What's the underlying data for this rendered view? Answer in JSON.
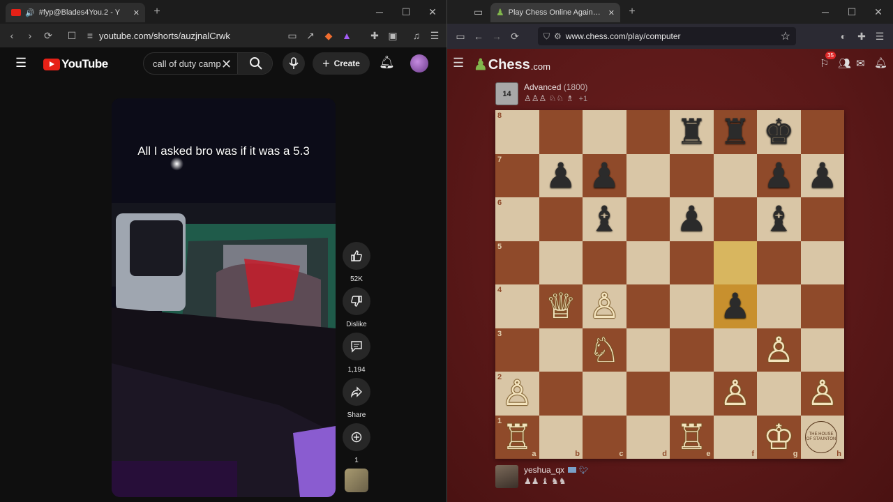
{
  "left_browser": {
    "tab_title": "#fyp@Blades4You.2 - Y",
    "url": "youtube.com/shorts/auzjnalCrwk",
    "window_controls": [
      "minimize",
      "maximize",
      "close"
    ]
  },
  "youtube": {
    "logo_text": "YouTube",
    "search_value": "call of duty camp",
    "create_label": "Create",
    "caption": "All I asked bro was if it was a 5.3",
    "actions": [
      {
        "icon": "thumbs-up-icon",
        "label": "52K"
      },
      {
        "icon": "thumbs-down-icon",
        "label": "Dislike"
      },
      {
        "icon": "comment-icon",
        "label": "1,194"
      },
      {
        "icon": "share-icon",
        "label": "Share"
      },
      {
        "icon": "remix-icon",
        "label": "1"
      }
    ]
  },
  "right_browser": {
    "tab_title": "Play Chess Online Against the C",
    "url": "www.chess.com/play/computer"
  },
  "chess": {
    "logo_text": "Chess",
    "logo_suffix": ".com",
    "notification_count": "35",
    "opponent": {
      "badge": "14",
      "name": "Advanced",
      "rating": "(1800)",
      "captured": "♙♙♙ ♘♘ ♗",
      "advantage": "+1"
    },
    "player": {
      "name": "yeshua_qx",
      "captured": "♟♟ ♝ ♞♞"
    },
    "ranks": [
      "8",
      "7",
      "6",
      "5",
      "4",
      "3",
      "2",
      "1"
    ],
    "files": [
      "a",
      "b",
      "c",
      "d",
      "e",
      "f",
      "g",
      "h"
    ],
    "highlight_squares": [
      "f5",
      "f4"
    ],
    "pieces": [
      {
        "sq": "e8",
        "glyph": "♜",
        "side": "b"
      },
      {
        "sq": "f8",
        "glyph": "♜",
        "side": "b"
      },
      {
        "sq": "g8",
        "glyph": "♚",
        "side": "b"
      },
      {
        "sq": "b7",
        "glyph": "♟",
        "side": "b"
      },
      {
        "sq": "c7",
        "glyph": "♟",
        "side": "b"
      },
      {
        "sq": "g7",
        "glyph": "♟",
        "side": "b"
      },
      {
        "sq": "h7",
        "glyph": "♟",
        "side": "b"
      },
      {
        "sq": "c6",
        "glyph": "♝",
        "side": "b"
      },
      {
        "sq": "e6",
        "glyph": "♟",
        "side": "b"
      },
      {
        "sq": "g6",
        "glyph": "♝",
        "side": "b"
      },
      {
        "sq": "f4",
        "glyph": "♟",
        "side": "b"
      },
      {
        "sq": "b4",
        "glyph": "♕",
        "side": "w"
      },
      {
        "sq": "c4",
        "glyph": "♙",
        "side": "w"
      },
      {
        "sq": "c3",
        "glyph": "♘",
        "side": "w"
      },
      {
        "sq": "g3",
        "glyph": "♙",
        "side": "w"
      },
      {
        "sq": "a2",
        "glyph": "♙",
        "side": "w"
      },
      {
        "sq": "f2",
        "glyph": "♙",
        "side": "w"
      },
      {
        "sq": "h2",
        "glyph": "♙",
        "side": "w"
      },
      {
        "sq": "a1",
        "glyph": "♖",
        "side": "w"
      },
      {
        "sq": "e1",
        "glyph": "♖",
        "side": "w"
      },
      {
        "sq": "g1",
        "glyph": "♔",
        "side": "w"
      }
    ],
    "seal_text": "THE HOUSE OF STAUNTON"
  }
}
